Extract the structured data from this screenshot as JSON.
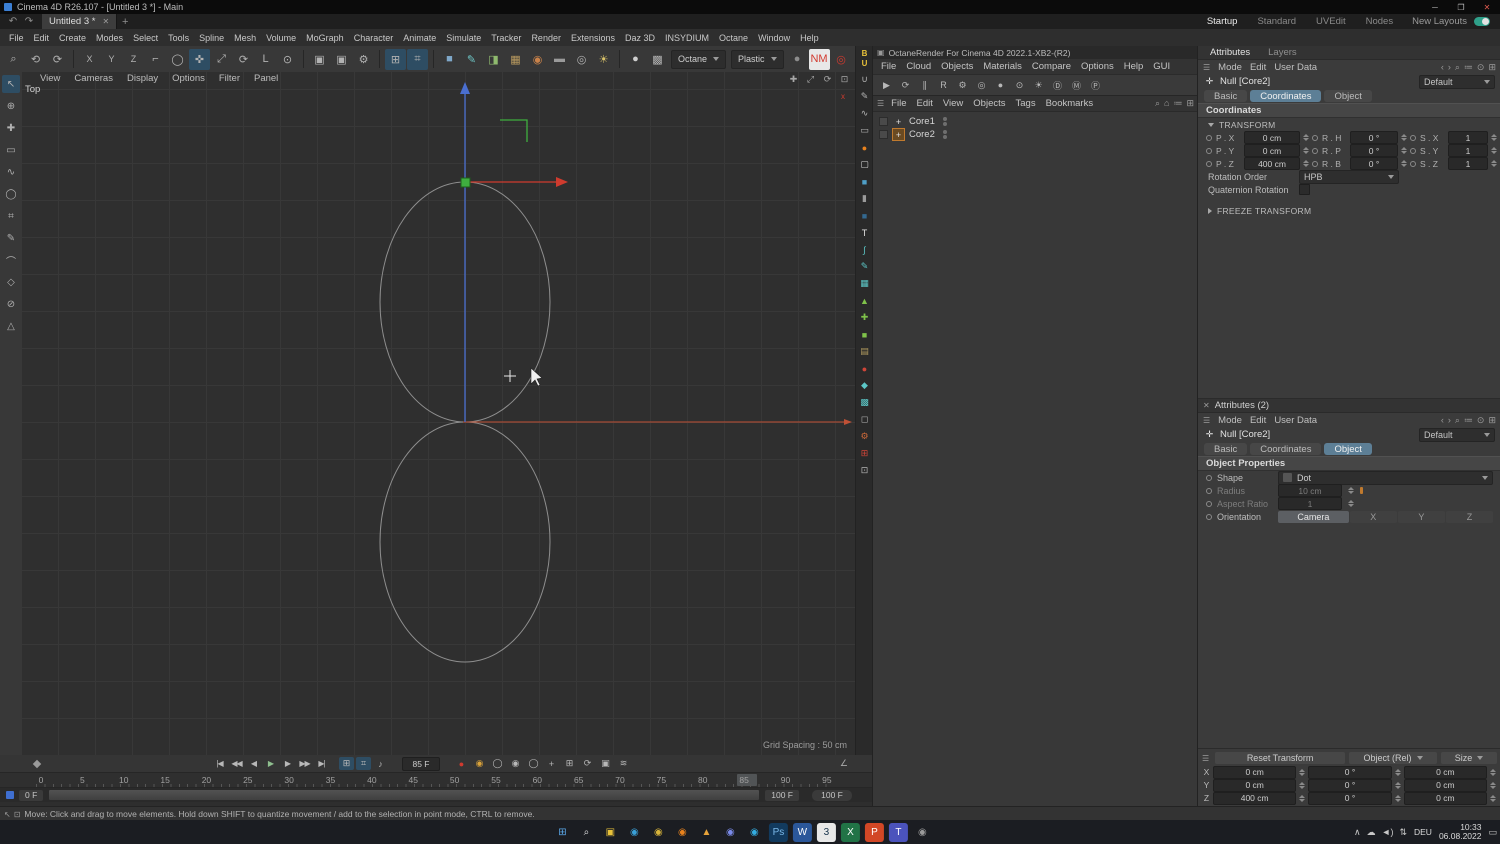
{
  "ui": {
    "burger": "☰"
  },
  "titlebar": {
    "title": "Cinema 4D R26.107 - [Untitled 3 *] - Main",
    "minimize": "─",
    "maximize": "❐",
    "close": "✕"
  },
  "tabbar": {
    "icons": [
      {
        "name": "undo-icon",
        "glyph": "↶"
      },
      {
        "name": "redo-icon",
        "glyph": "↷"
      }
    ],
    "tab": "Untitled 3 *",
    "tab_close": "✕",
    "add_tab": "+",
    "layouts": [
      {
        "name": "layout-startup",
        "label": "Startup",
        "selected": true
      },
      {
        "name": "layout-standard",
        "label": "Standard"
      },
      {
        "name": "layout-uvedit",
        "label": "UVEdit"
      },
      {
        "name": "layout-nodes",
        "label": "Nodes"
      }
    ],
    "new_layouts": "New Layouts"
  },
  "menubar": {
    "items": [
      "File",
      "Edit",
      "Create",
      "Modes",
      "Select",
      "Tools",
      "Spline",
      "Mesh",
      "Volume",
      "MoGraph",
      "Character",
      "Animate",
      "Simulate",
      "Tracker",
      "Render",
      "Extensions",
      "Daz 3D",
      "INSYDIUM",
      "Octane",
      "Window",
      "Help"
    ]
  },
  "toolbar": {
    "icons_a": [
      {
        "name": "search-icon",
        "glyph": "⌕"
      },
      {
        "name": "undo-icon",
        "glyph": "⟲"
      },
      {
        "name": "redo-icon",
        "glyph": "⟳"
      }
    ],
    "axis_locks": [
      {
        "name": "axis-x-lock",
        "glyph": "X"
      },
      {
        "name": "axis-y-lock",
        "glyph": "Y"
      },
      {
        "name": "axis-z-lock",
        "glyph": "Z"
      }
    ],
    "icons_b": [
      {
        "name": "coordinate-system-icon",
        "glyph": "⌐"
      },
      {
        "name": "live-selection-icon",
        "glyph": "◯"
      },
      {
        "name": "move-tool-icon",
        "glyph": "✜",
        "selected": true
      },
      {
        "name": "scale-tool-icon",
        "glyph": "⤢"
      },
      {
        "name": "rotate-tool-icon",
        "glyph": "⟳"
      },
      {
        "name": "last-tool-icon",
        "glyph": "L"
      },
      {
        "name": "workplane-lock-icon",
        "glyph": "⊙"
      }
    ],
    "icons_c": [
      {
        "name": "render-view-icon",
        "glyph": "▣"
      },
      {
        "name": "render-picture-viewer-icon",
        "glyph": "▣"
      },
      {
        "name": "render-settings-icon",
        "glyph": "⚙"
      }
    ],
    "icons_d": [
      {
        "name": "snap-grid-icon",
        "glyph": "⊞",
        "selected": true
      },
      {
        "name": "quantize-icon",
        "glyph": "⌗",
        "selected": true
      }
    ],
    "icons_e": [
      {
        "name": "cube-primitive-icon",
        "glyph": "■",
        "color": "#7fa8c9"
      },
      {
        "name": "pen-spline-icon",
        "glyph": "✎",
        "color": "#6ec6c6"
      },
      {
        "name": "mograph-cloner-icon",
        "glyph": "◨",
        "color": "#8fba6e"
      },
      {
        "name": "volume-icon",
        "glyph": "▦",
        "color": "#b99a5f"
      },
      {
        "name": "field-icon",
        "glyph": "◉",
        "color": "#c9824a"
      },
      {
        "name": "floor-icon",
        "glyph": "▬",
        "color": "#9a9a9a"
      },
      {
        "name": "camera-icon",
        "glyph": "◎"
      },
      {
        "name": "light-icon",
        "glyph": "☀",
        "color": "#d9c36a"
      }
    ],
    "icons_f": [
      {
        "name": "material-sphere-icon",
        "glyph": "●",
        "color": "#cfcfcf"
      },
      {
        "name": "material-checker-icon",
        "glyph": "▩"
      }
    ],
    "render_engine_label": "Octane",
    "material_preset_label": "Plastic",
    "icons_g": [
      {
        "name": "gray-sphere-icon",
        "glyph": "●",
        "color": "#8d8d8d"
      },
      {
        "name": "nm-plugin-icon",
        "glyph": "NM",
        "color": "#d23a2f",
        "bg": "#e8e8e8"
      },
      {
        "name": "octane-logo-icon",
        "glyph": "◎",
        "color": "#d23a2f"
      },
      {
        "name": "flame-plugin-icon",
        "glyph": "✦",
        "color": "#e8821d"
      },
      {
        "name": "insydium-plugin-icon",
        "glyph": "◆",
        "color": "#d9b93a"
      },
      {
        "name": "xparticles-icon",
        "glyph": "✸",
        "color": "#46b2b2"
      }
    ],
    "icons_h": [
      {
        "name": "magnet-snap-icon",
        "glyph": "∪"
      },
      {
        "name": "workplane-icon",
        "glyph": "⊡"
      }
    ]
  },
  "left_toolbar": {
    "icons": [
      {
        "name": "pointer-tool-icon",
        "glyph": "↖",
        "selected": true
      },
      {
        "name": "target-tool-icon",
        "glyph": "⊕"
      },
      {
        "name": "add-point-tool-icon",
        "glyph": "✚"
      },
      {
        "name": "rect-select-tool-icon",
        "glyph": "▭"
      },
      {
        "name": "freehand-spline-tool-icon",
        "glyph": "∿"
      },
      {
        "name": "circle-tool-icon",
        "glyph": "◯"
      },
      {
        "name": "grid-tool-icon",
        "glyph": "⌗"
      },
      {
        "name": "sketch-tool-icon",
        "glyph": "✎"
      },
      {
        "name": "arc-tool-icon",
        "glyph": "⌒"
      },
      {
        "name": "diamond-tool-icon",
        "glyph": "◇"
      },
      {
        "name": "disable-tool-icon",
        "glyph": "⊘"
      },
      {
        "name": "triangle-tool-icon",
        "glyph": "△"
      }
    ]
  },
  "viewport": {
    "menus": [
      "View",
      "Cameras",
      "Display",
      "Options",
      "Filter",
      "Panel"
    ],
    "nav_icons": [
      {
        "name": "pan-view-icon",
        "glyph": "✚"
      },
      {
        "name": "zoom-view-icon",
        "glyph": "⤢"
      },
      {
        "name": "rotate-view-icon",
        "glyph": "⟳"
      },
      {
        "name": "toggle-view-icon",
        "glyph": "⊡"
      }
    ],
    "view_label": "Top",
    "axis_hint": "x",
    "grid_spacing_label": "Grid Spacing : 50 cm"
  },
  "midstrip": {
    "logo": "BU",
    "icons": [
      {
        "name": "magnet-icon",
        "glyph": "∪"
      },
      {
        "name": "pen-icon",
        "glyph": "✎"
      },
      {
        "name": "fcurve-icon",
        "glyph": "∿"
      },
      {
        "name": "ruler-icon",
        "glyph": "▭"
      },
      {
        "name": "octane-ball-icon",
        "glyph": "●",
        "color": "#e8821d"
      },
      {
        "name": "frame-icon",
        "glyph": "▢",
        "color": "#d0d0d0"
      },
      {
        "name": "cube-blue-icon",
        "glyph": "■",
        "color": "#4f9fc7"
      },
      {
        "name": "cylinder-icon",
        "glyph": "▮",
        "color": "#9a9a9a"
      },
      {
        "name": "cube-dark-icon",
        "glyph": "■",
        "color": "#33688f"
      },
      {
        "name": "text-tool-icon",
        "glyph": "T",
        "color": "#e0e0e0"
      },
      {
        "name": "spline-icon",
        "glyph": "∫",
        "color": "#5cc7c7"
      },
      {
        "name": "spline-pen-icon",
        "glyph": "✎",
        "color": "#5cc7c7"
      },
      {
        "name": "mesh-grid-icon",
        "glyph": "▦",
        "color": "#5cc7c7"
      },
      {
        "name": "triangle-green-icon",
        "glyph": "▲",
        "color": "#7fc24a"
      },
      {
        "name": "plus-green-icon",
        "glyph": "✚",
        "color": "#7fc24a"
      },
      {
        "name": "cube-green-icon",
        "glyph": "■",
        "color": "#7fc24a"
      },
      {
        "name": "cube-tan-icon",
        "glyph": "▤",
        "color": "#b09a5f"
      },
      {
        "name": "ball-red-icon",
        "glyph": "●",
        "color": "#cf4538"
      },
      {
        "name": "diamond-teal-icon",
        "glyph": "◆",
        "color": "#5cc7c7"
      },
      {
        "name": "hatch-teal-icon",
        "glyph": "▩",
        "color": "#5cc7c7"
      },
      {
        "name": "square-gray-icon",
        "glyph": "◻",
        "color": "#b5b5b5"
      },
      {
        "name": "gear-orange-icon",
        "glyph": "⚙",
        "color": "#d06a3a"
      },
      {
        "name": "cross-red-icon",
        "glyph": "⊞",
        "color": "#cf4538"
      },
      {
        "name": "plug-icon",
        "glyph": "⊡",
        "color": "#b5b5b5"
      }
    ]
  },
  "octane": {
    "title_icon": "▣",
    "title": "OctaneRender For Cinema 4D 2022.1-XB2-(R2)",
    "menus": [
      "File",
      "Cloud",
      "Objects",
      "Materials",
      "Compare",
      "Options",
      "Help",
      "GUI"
    ],
    "toolbar": [
      {
        "name": "render-start-icon",
        "glyph": "▶"
      },
      {
        "name": "render-restart-icon",
        "glyph": "⟳"
      },
      {
        "name": "render-pause-icon",
        "glyph": "∥"
      },
      {
        "name": "render-region-icon",
        "glyph": "R"
      },
      {
        "name": "settings-icon",
        "glyph": "⚙"
      },
      {
        "name": "camera-icon",
        "glyph": "◎"
      },
      {
        "name": "material-ball-icon",
        "glyph": "●"
      },
      {
        "name": "lock-resolution-icon",
        "glyph": "⊙"
      },
      {
        "name": "sun-icon",
        "glyph": "☀"
      },
      {
        "name": "daylight-icon",
        "glyph": "Ⓓ"
      },
      {
        "name": "material-browser-icon",
        "glyph": "Ⓜ"
      },
      {
        "name": "preferences-icon",
        "glyph": "Ⓟ"
      }
    ]
  },
  "object_manager": {
    "menus": [
      "File",
      "Edit",
      "View",
      "Objects",
      "Tags",
      "Bookmarks"
    ],
    "right_icons": [
      {
        "name": "search-icon",
        "glyph": "⌕"
      },
      {
        "name": "home-icon",
        "glyph": "⌂"
      },
      {
        "name": "filter-icon",
        "glyph": "≔"
      },
      {
        "name": "panel-icon",
        "glyph": "⊞"
      }
    ],
    "obj_icon": "+",
    "objects": [
      {
        "label": "Core1"
      },
      {
        "label": "Core2",
        "selected": true
      }
    ]
  },
  "panel_icons": [
    {
      "name": "back-arrow-icon",
      "glyph": "‹"
    },
    {
      "name": "forward-arrow-icon",
      "glyph": "›"
    },
    {
      "name": "search-icon",
      "glyph": "⌕"
    },
    {
      "name": "filter-icon",
      "glyph": "≔"
    },
    {
      "name": "lock-icon",
      "glyph": "⊙"
    },
    {
      "name": "popup-icon",
      "glyph": "⊞"
    }
  ],
  "attributes1": {
    "panel_tabs": [
      {
        "name": "tab-attributes",
        "label": "Attributes",
        "selected": true
      },
      {
        "name": "tab-layers",
        "label": "Layers"
      }
    ],
    "menus": [
      "Mode",
      "Edit",
      "User Data"
    ],
    "obj_icon": "✛",
    "object_label": "Null [Core2]",
    "preset_label": "Default",
    "tabs": [
      {
        "name": "tab-basic",
        "label": "Basic"
      },
      {
        "name": "tab-coordinates",
        "label": "Coordinates",
        "selected": true
      },
      {
        "name": "tab-object",
        "label": "Object"
      }
    ],
    "section_title": "Coordinates",
    "transform_title": "TRANSFORM",
    "rows": [
      {
        "l1": "P . X",
        "v1": "0 cm",
        "l2": "R . H",
        "v2": "0 °",
        "l3": "S . X",
        "v3": "1"
      },
      {
        "l1": "P . Y",
        "v1": "0 cm",
        "l2": "R . P",
        "v2": "0 °",
        "l3": "S . Y",
        "v3": "1"
      },
      {
        "l1": "P . Z",
        "v1": "400 cm",
        "l2": "R . B",
        "v2": "0 °",
        "l3": "S . Z",
        "v3": "1"
      }
    ],
    "rotation_order_label": "Rotation Order",
    "rotation_order_value": "HPB",
    "quaternion_label": "Quaternion Rotation",
    "freeze_title": "FREEZE TRANSFORM"
  },
  "attributes2": {
    "close_icon": "✕",
    "title": "Attributes (2)",
    "menus": [
      "Mode",
      "Edit",
      "User Data"
    ],
    "obj_icon": "✛",
    "object_label": "Null [Core2]",
    "preset_label": "Default",
    "tabs": [
      {
        "name": "tab-basic",
        "label": "Basic"
      },
      {
        "name": "tab-coordinates",
        "label": "Coordinates"
      },
      {
        "name": "tab-object",
        "label": "Object",
        "selected": true
      }
    ],
    "section_title": "Object Properties",
    "shape_label": "Shape",
    "shape_value": "Dot",
    "radius_label": "Radius",
    "radius_value": "10 cm",
    "aspect_label": "Aspect Ratio",
    "aspect_value": "1",
    "orientation_label": "Orientation",
    "orientation_options": [
      {
        "name": "orientation-camera",
        "label": "Camera",
        "selected": true
      },
      {
        "name": "orientation-x",
        "label": "X"
      },
      {
        "name": "orientation-y",
        "label": "Y"
      },
      {
        "name": "orientation-z",
        "label": "Z"
      }
    ]
  },
  "coords": {
    "reset_label": "Reset Transform",
    "mode_label": "Object (Rel)",
    "size_label": "Size",
    "rows": [
      {
        "axis": "X",
        "pos": "0 cm",
        "rot": "0 °",
        "size": "0 cm"
      },
      {
        "axis": "Y",
        "pos": "0 cm",
        "rot": "0 °",
        "size": "0 cm"
      },
      {
        "axis": "Z",
        "pos": "400 cm",
        "rot": "0 °",
        "size": "0 cm"
      }
    ]
  },
  "timeline": {
    "transport": [
      {
        "name": "goto-start-button",
        "glyph": "|◀"
      },
      {
        "name": "prev-key-button",
        "glyph": "◀◀"
      },
      {
        "name": "prev-frame-button",
        "glyph": "◀"
      },
      {
        "name": "play-button",
        "glyph": "▶",
        "color": "#8fbf8f"
      },
      {
        "name": "next-frame-button",
        "glyph": "▶"
      },
      {
        "name": "next-key-button",
        "glyph": "▶▶"
      },
      {
        "name": "goto-end-button",
        "glyph": "▶|"
      }
    ],
    "toggles": [
      {
        "name": "keyframe-bar-toggle",
        "glyph": "⊞",
        "selected": true
      },
      {
        "name": "quantize-toggle",
        "glyph": "⌗",
        "selected": true
      },
      {
        "name": "sound-toggle",
        "glyph": "♪"
      }
    ],
    "current_frame": "85 F",
    "record_icons": [
      {
        "name": "record-keyframe-icon",
        "glyph": "●",
        "color": "#cf3a2f"
      },
      {
        "name": "autokey-icon",
        "glyph": "◉",
        "color": "#d9a23a"
      },
      {
        "name": "keyframe-selection-icon",
        "glyph": "◯"
      },
      {
        "name": "record-filter-icon",
        "glyph": "◉"
      },
      {
        "name": "record-mode-icon",
        "glyph": "◯"
      },
      {
        "name": "record-position-icon",
        "glyph": "+"
      },
      {
        "name": "record-scale-icon",
        "glyph": "⊞"
      },
      {
        "name": "record-rotation-icon",
        "glyph": "⟳"
      },
      {
        "name": "record-parameter-icon",
        "glyph": "▣"
      },
      {
        "name": "record-pla-icon",
        "glyph": "≋"
      }
    ],
    "right_icons": [
      {
        "name": "mini-fcurve-icon",
        "glyph": "∠"
      }
    ],
    "ticks": [
      "0",
      "5",
      "10",
      "15",
      "20",
      "25",
      "30",
      "35",
      "40",
      "45",
      "50",
      "55",
      "60",
      "65",
      "70",
      "75",
      "80",
      "85",
      "90",
      "95"
    ],
    "range_start": "0 F",
    "range_end": "100 F",
    "range_total": "100 F"
  },
  "status": {
    "icons": [
      {
        "name": "cursor-icon",
        "glyph": "↖"
      },
      {
        "name": "grid-icon",
        "glyph": "⊡"
      }
    ],
    "text": "Move: Click and drag to move elements. Hold down SHIFT to quantize movement / add to the selection in point mode, CTRL to remove."
  },
  "taskbar": {
    "apps": [
      {
        "name": "start-button",
        "glyph": "⊞",
        "color": "#5aa7e8"
      },
      {
        "name": "search-icon",
        "glyph": "⌕",
        "color": "#e0e0e0"
      },
      {
        "name": "file-explorer-icon",
        "glyph": "▣",
        "color": "#e8c23a"
      },
      {
        "name": "edge-icon",
        "glyph": "◉",
        "color": "#3aa0d8"
      },
      {
        "name": "chrome-icon",
        "glyph": "◉",
        "color": "#d8b43a"
      },
      {
        "name": "firefox-icon",
        "glyph": "◉",
        "color": "#e8821d"
      },
      {
        "name": "media-icon",
        "glyph": "▲",
        "color": "#e8a33a"
      },
      {
        "name": "discord-icon",
        "glyph": "◉",
        "color": "#7a8ae8"
      },
      {
        "name": "telegram-icon",
        "glyph": "◉",
        "color": "#34ace0"
      },
      {
        "name": "photoshop-icon",
        "glyph": "Ps",
        "color": "#7ab8e8",
        "bg": "#123a5e"
      },
      {
        "name": "word-icon",
        "glyph": "W",
        "color": "#ffffff",
        "bg": "#2b579a"
      },
      {
        "name": "badge-3-icon",
        "glyph": "3",
        "color": "#16324a",
        "bg": "#e8e8e8"
      },
      {
        "name": "excel-icon",
        "glyph": "X",
        "color": "#ffffff",
        "bg": "#217346"
      },
      {
        "name": "powerpoint-icon",
        "glyph": "P",
        "color": "#ffffff",
        "bg": "#d24726"
      },
      {
        "name": "teams-icon",
        "glyph": "T",
        "color": "#ffffff",
        "bg": "#4b53bc"
      },
      {
        "name": "settings-app-icon",
        "glyph": "◉",
        "color": "#9a9a9a"
      }
    ],
    "tray": [
      {
        "name": "tray-expand-icon",
        "glyph": "∧"
      },
      {
        "name": "onedrive-icon",
        "glyph": "☁"
      },
      {
        "name": "volume-icon",
        "glyph": "◄)"
      },
      {
        "name": "network-icon",
        "glyph": "⇅"
      }
    ],
    "lang": "DEU",
    "time": "10:33",
    "date": "06.08.2022"
  }
}
